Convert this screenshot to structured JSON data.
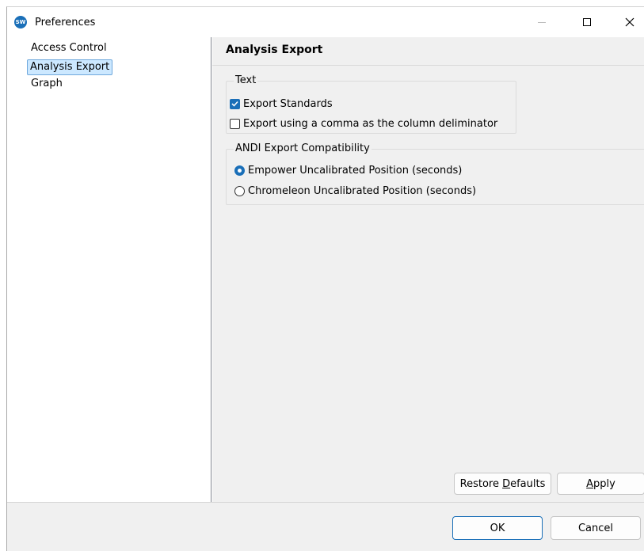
{
  "window": {
    "title": "Preferences",
    "app_icon_text": "SW"
  },
  "tree": {
    "items": [
      {
        "label": "Access Control",
        "selected": false
      },
      {
        "label": "Analysis Export",
        "selected": true
      },
      {
        "label": "Graph",
        "selected": false
      }
    ]
  },
  "page": {
    "title": "Analysis Export",
    "text_group": {
      "label": "Text",
      "options": [
        {
          "label": "Export Standards",
          "checked": true
        },
        {
          "label": "Export using a comma as the column deliminator",
          "checked": false
        }
      ]
    },
    "andi_group": {
      "label": "ANDI Export Compatibility",
      "options": [
        {
          "label": "Empower Uncalibrated Position (seconds)",
          "selected": true
        },
        {
          "label": "Chromeleon Uncalibrated Position (seconds)",
          "selected": false
        }
      ]
    },
    "restore_defaults": {
      "pre": "Restore ",
      "mnemonic": "D",
      "post": "efaults"
    },
    "apply": {
      "pre": "",
      "mnemonic": "A",
      "post": "pply"
    }
  },
  "footer": {
    "ok_label": "OK",
    "cancel_label": "Cancel"
  },
  "colors": {
    "accent": "#1a6fb8",
    "selection_bg": "#cce8ff",
    "dialog_bg": "#f0f0f0"
  }
}
